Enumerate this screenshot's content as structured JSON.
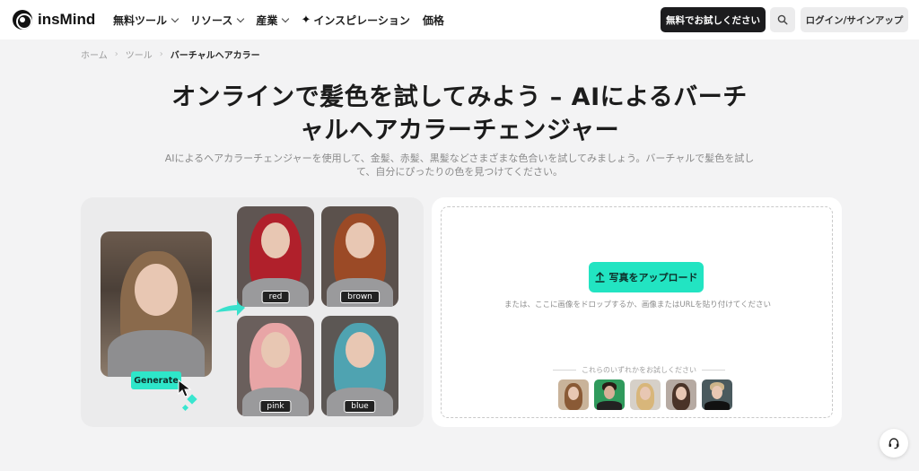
{
  "header": {
    "logo_text": "insMind",
    "nav": [
      {
        "label": "無料ツール",
        "has_dropdown": true
      },
      {
        "label": "リソース",
        "has_dropdown": true
      },
      {
        "label": "産業",
        "has_dropdown": true
      },
      {
        "label": "インスピレーション",
        "has_dropdown": false
      },
      {
        "label": "価格",
        "has_dropdown": false
      }
    ],
    "trial_label": "無料でお試しください",
    "login_label": "ログイン/サインアップ"
  },
  "breadcrumb": {
    "items": [
      "ホーム",
      "ツール",
      "バーチャルヘアカラー"
    ]
  },
  "hero": {
    "title_line1": "オンラインで髪色を試してみよう – AIによるバーチ",
    "title_line2": "ャルヘアカラーチェンジャー",
    "subtitle_line1": "AIによるヘアカラーチェンジャーを使用して、金髪、赤髪、黒髪などさまざまな色合いを試してみましょう。バーチャルで髪色を試し",
    "subtitle_line2": "て、自分にぴったりの色を見つけてください。"
  },
  "demo": {
    "generate_label": "Generate",
    "labels": {
      "red": "red",
      "brown": "brown",
      "pink": "pink",
      "blue": "blue"
    }
  },
  "upload": {
    "button_label": "写真をアップロード",
    "hint": "または、ここに画像をドロップするか、画像またはURLを貼り付けてください",
    "try_label": "これらのいずれかをお試しください",
    "samples": [
      "sample-1",
      "sample-2",
      "sample-3",
      "sample-4",
      "sample-5"
    ]
  },
  "colors": {
    "accent": "#22e4c2",
    "dark_button": "#1c1c1e"
  }
}
